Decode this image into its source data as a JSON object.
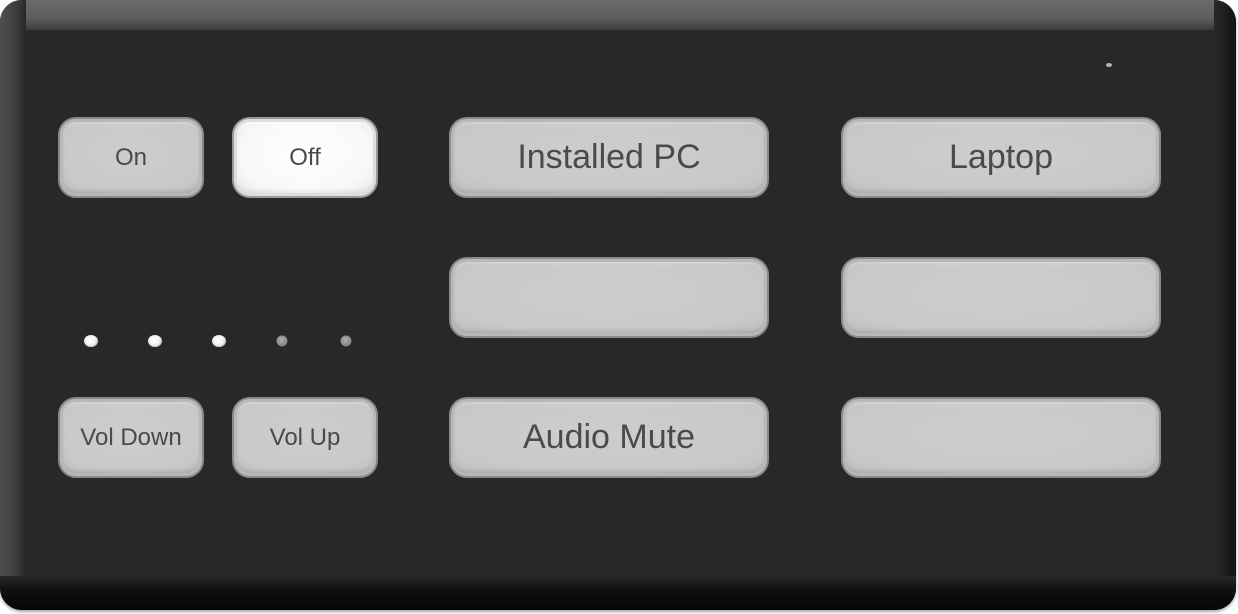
{
  "power": {
    "on_label": "On",
    "off_label": "Off",
    "active": "off"
  },
  "volume": {
    "down_label": "Vol Down",
    "up_label": "Vol Up",
    "level_steps": 5,
    "level": 3
  },
  "sources": {
    "column1": [
      {
        "label": "Installed PC"
      },
      {
        "label": ""
      },
      {
        "label": "Audio Mute"
      }
    ],
    "column2": [
      {
        "label": "Laptop"
      },
      {
        "label": ""
      },
      {
        "label": ""
      }
    ]
  },
  "colors": {
    "panel": "#282828",
    "button": "#c9c9c9",
    "button_active": "#f8f8f8",
    "button_text": "#4a4a4a",
    "level_on": "#f2f2f2",
    "level_off": "#8a8a8a"
  }
}
